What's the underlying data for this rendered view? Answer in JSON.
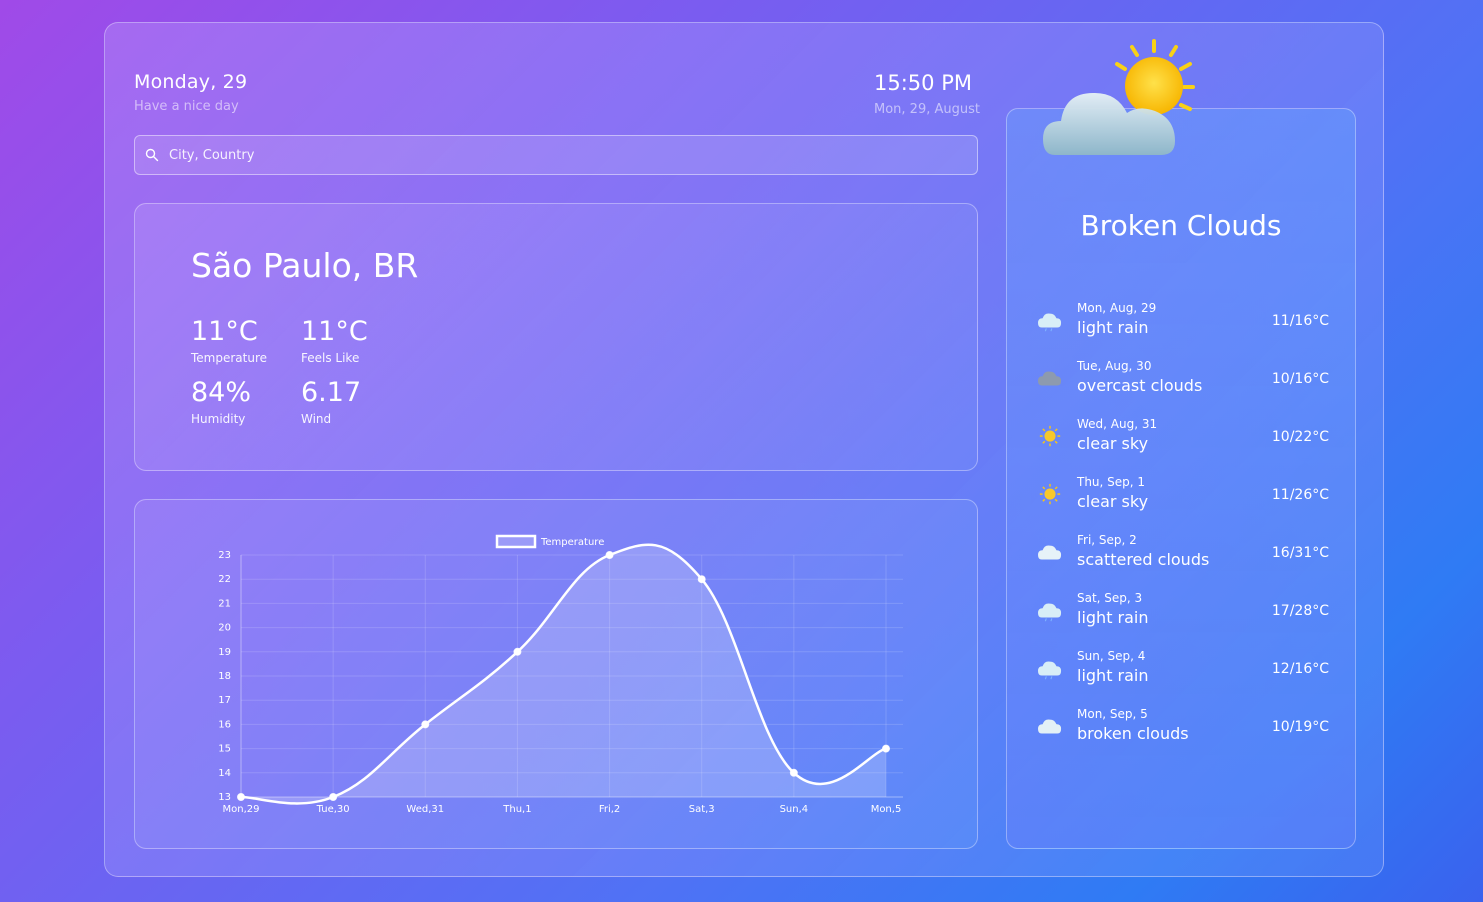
{
  "header": {
    "date_title": "Monday, 29",
    "greeting": "Have a nice day",
    "time": "15:50 PM",
    "date_sub": "Mon, 29, August"
  },
  "search": {
    "placeholder": "City, Country",
    "value": ""
  },
  "current": {
    "city": "São Paulo, BR",
    "temperature": "11°C",
    "temperature_label": "Temperature",
    "feels_like": "11°C",
    "feels_like_label": "Feels Like",
    "humidity": "84%",
    "humidity_label": "Humidity",
    "wind": "6.17",
    "wind_label": "Wind"
  },
  "forecast": {
    "condition": "Broken Clouds",
    "icon": "partly-cloudy-sun-icon",
    "days": [
      {
        "date": "Mon, Aug, 29",
        "desc": "light rain",
        "temp": "11/16°C",
        "icon": "rain-cloud-icon"
      },
      {
        "date": "Tue, Aug, 30",
        "desc": "overcast clouds",
        "temp": "10/16°C",
        "icon": "overcast-cloud-icon"
      },
      {
        "date": "Wed, Aug, 31",
        "desc": "clear sky",
        "temp": "10/22°C",
        "icon": "sun-icon"
      },
      {
        "date": "Thu, Sep, 1",
        "desc": "clear sky",
        "temp": "11/26°C",
        "icon": "sun-icon"
      },
      {
        "date": "Fri, Sep, 2",
        "desc": "scattered clouds",
        "temp": "16/31°C",
        "icon": "cloud-icon"
      },
      {
        "date": "Sat, Sep, 3",
        "desc": "light rain",
        "temp": "17/28°C",
        "icon": "rain-cloud-icon"
      },
      {
        "date": "Sun, Sep, 4",
        "desc": "light rain",
        "temp": "12/16°C",
        "icon": "rain-cloud-icon"
      },
      {
        "date": "Mon, Sep, 5",
        "desc": "broken clouds",
        "temp": "10/19°C",
        "icon": "broken-cloud-icon"
      }
    ]
  },
  "chart_data": {
    "type": "line",
    "legend": "Temperature",
    "legend_position": "top-center",
    "categories": [
      "Mon,29",
      "Tue,30",
      "Wed,31",
      "Thu,1",
      "Fri,2",
      "Sat,3",
      "Sun,4",
      "Mon,5"
    ],
    "series": [
      {
        "name": "Temperature",
        "values": [
          13,
          13,
          16,
          19,
          23,
          22,
          14,
          15
        ]
      }
    ],
    "ylim": [
      13,
      23
    ],
    "yticks": [
      13,
      14,
      15,
      16,
      17,
      18,
      19,
      20,
      21,
      22,
      23
    ],
    "grid": true,
    "fill": true
  }
}
